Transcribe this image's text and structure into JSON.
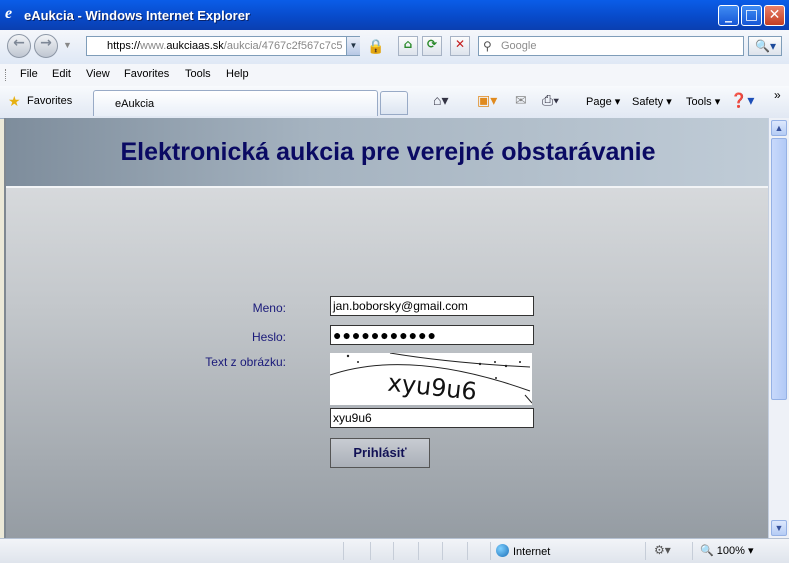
{
  "window": {
    "title": "eAukcia - Windows Internet Explorer",
    "logo_glyph": "e"
  },
  "address_bar": {
    "protocol": "https://",
    "domain_prefix": "www.",
    "domain": "aukciaas.sk",
    "path": "/aukcia/4767c2f567c7c5"
  },
  "search": {
    "placeholder": "Google"
  },
  "menu": [
    "File",
    "Edit",
    "View",
    "Favorites",
    "Tools",
    "Help"
  ],
  "favorites": {
    "label": "Favorites"
  },
  "tab": {
    "label": "eAukcia"
  },
  "commands": {
    "page": "Page",
    "safety": "Safety",
    "tools": "Tools"
  },
  "page": {
    "title": "Elektronická aukcia pre verejné obstarávanie",
    "form": {
      "username_label": "Meno:",
      "username_value": "jan.boborsky@gmail.com",
      "password_label": "Heslo:",
      "password_value": "●●●●●●●●●●●",
      "captcha_label": "Text z obrázku:",
      "captcha_image_text": "xyu9u6",
      "captcha_value": "xyu9u6",
      "submit_label": "Prihlásiť"
    }
  },
  "status": {
    "zone": "Internet",
    "zoom": "100%"
  },
  "colors": {
    "title_text": "#0a0a63",
    "label_text": "#1a1a7a",
    "window_titlebar": "#0849c8"
  }
}
